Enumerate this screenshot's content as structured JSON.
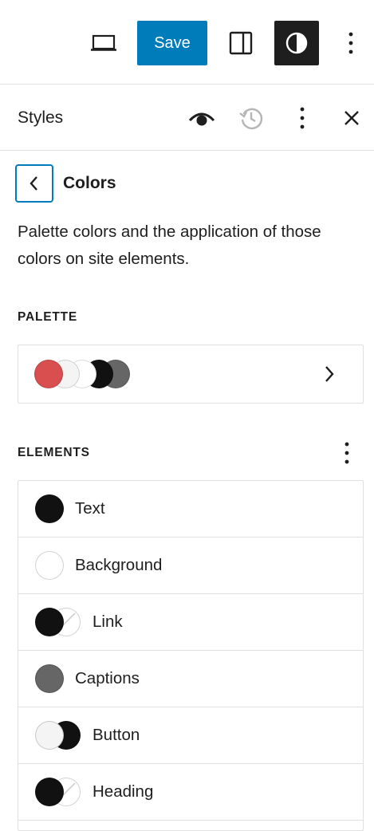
{
  "toolbar": {
    "save_label": "Save",
    "icons": [
      "laptop-icon",
      "sidebar-toggle-icon",
      "styles-half-circle-icon",
      "more-vertical-icon"
    ]
  },
  "panel": {
    "title": "Styles",
    "icons": [
      "eye-icon",
      "history-icon",
      "more-vertical-icon",
      "close-icon"
    ]
  },
  "nav": {
    "title": "Colors",
    "back_icon": "chevron-left-icon"
  },
  "description": "Palette colors and the application of those colors on site elements.",
  "palette": {
    "label": "PALETTE",
    "colors": [
      "#d94f4f",
      "#f4f4f4",
      "#ffffff",
      "#111111",
      "#666666"
    ]
  },
  "elements": {
    "label": "ELEMENTS",
    "items": [
      {
        "label": "Text",
        "swatches": [
          "#111111"
        ]
      },
      {
        "label": "Background",
        "swatches": [
          "#ffffff"
        ]
      },
      {
        "label": "Link",
        "swatches": [
          "#111111",
          "none"
        ]
      },
      {
        "label": "Captions",
        "swatches": [
          "#666666"
        ]
      },
      {
        "label": "Button",
        "swatches": [
          "#f4f4f4",
          "#111111"
        ]
      },
      {
        "label": "Heading",
        "swatches": [
          "#111111",
          "none"
        ]
      }
    ]
  },
  "colors": {
    "accent": "#007cba",
    "dark": "#1e1e1e",
    "border": "#e0e0e0"
  }
}
